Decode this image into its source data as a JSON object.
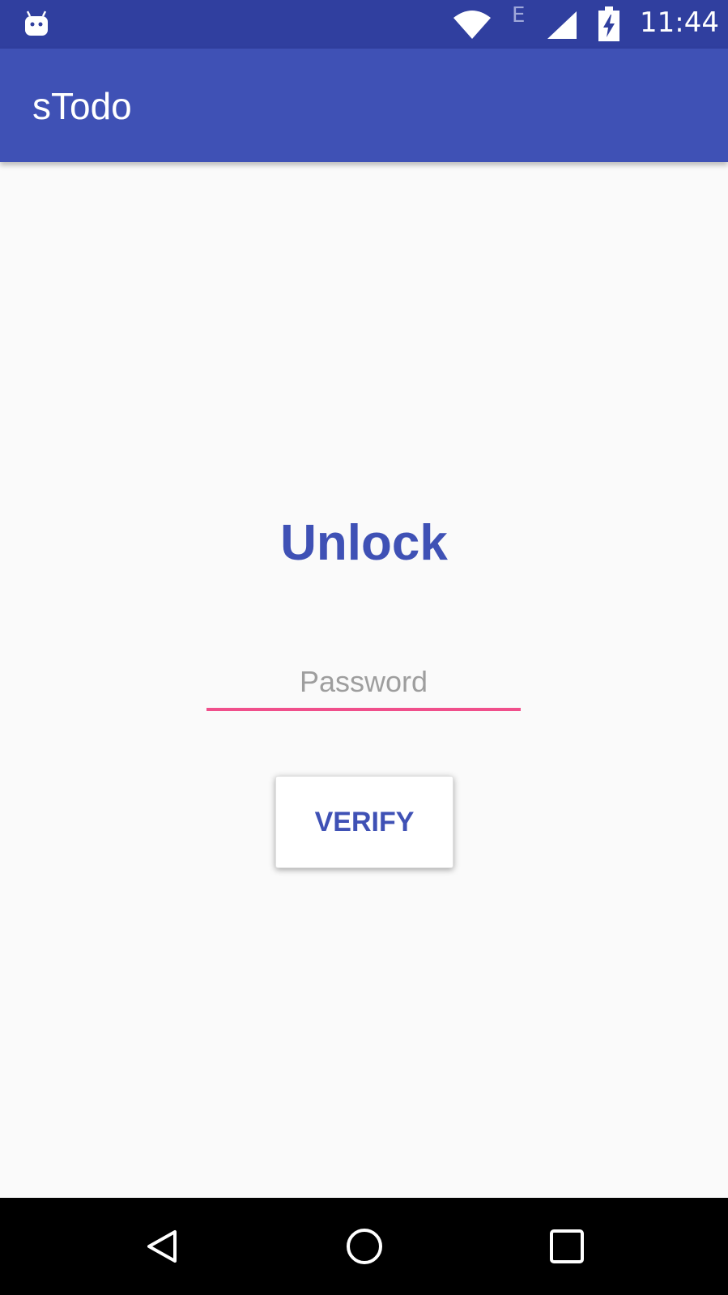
{
  "status_bar": {
    "network_type": "E",
    "time": "11:44",
    "icons": [
      "android-debug-icon",
      "wifi-icon",
      "signal-icon",
      "battery-charging-icon"
    ]
  },
  "app_bar": {
    "title": "sTodo"
  },
  "unlock": {
    "title": "Unlock",
    "password": {
      "value": "",
      "placeholder": "Password"
    },
    "verify_label": "VERIFY"
  },
  "nav_bar": {
    "icons": [
      "back-icon",
      "home-icon",
      "recents-icon"
    ]
  },
  "colors": {
    "status_bar": "#303F9F",
    "primary": "#3F51B5",
    "accent": "#F04F8B",
    "background": "#FAFAFA",
    "placeholder": "#9E9E9E"
  }
}
